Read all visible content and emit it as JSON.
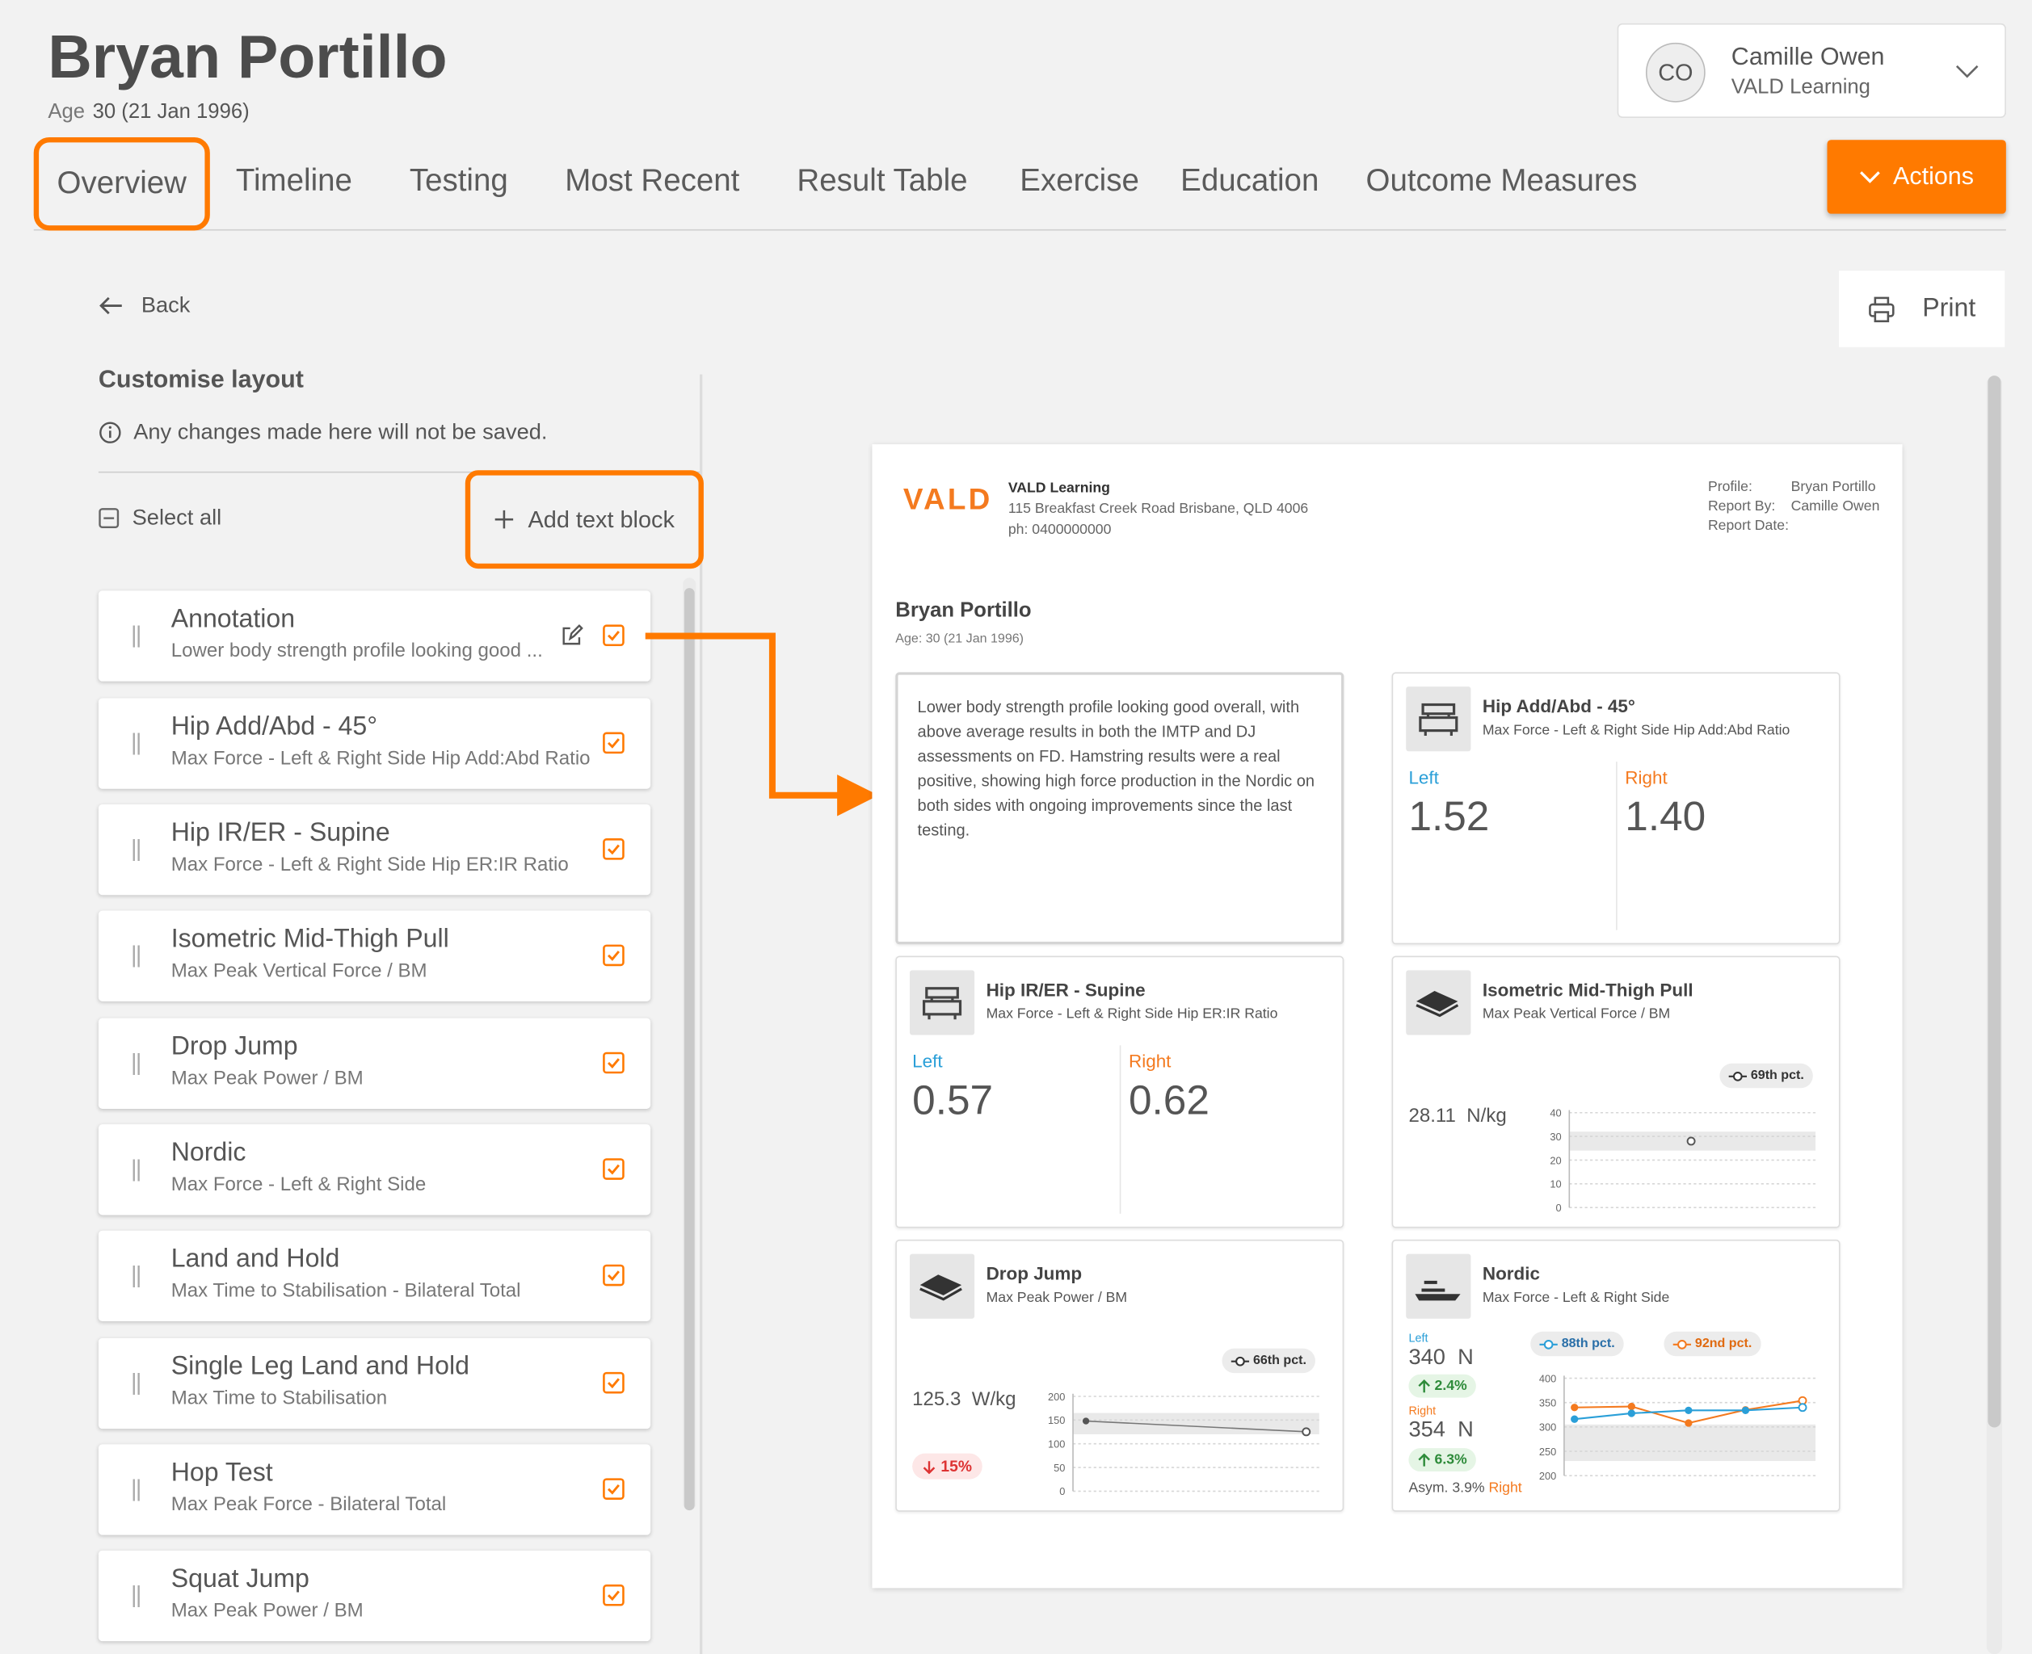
{
  "athlete": {
    "name": "Bryan Portillo",
    "age_label": "Age",
    "age_value": "30 (21 Jan 1996)"
  },
  "tabs": [
    {
      "label": "Overview",
      "active": true
    },
    {
      "label": "Timeline"
    },
    {
      "label": "Testing"
    },
    {
      "label": "Most Recent"
    },
    {
      "label": "Result Table"
    },
    {
      "label": "Exercise"
    },
    {
      "label": "Education"
    },
    {
      "label": "Outcome Measures"
    }
  ],
  "user": {
    "initials": "CO",
    "name": "Camille Owen",
    "org": "VALD Learning"
  },
  "actions_label": "Actions",
  "back_label": "Back",
  "print_label": "Print",
  "customise": {
    "title": "Customise layout",
    "note": "Any changes made here will not be saved.",
    "select_all": "Select all",
    "add_text_block": "Add text block",
    "items": [
      {
        "title": "Annotation",
        "subtitle": "Lower body strength profile looking good ...",
        "checked": true
      },
      {
        "title": "Hip Add/Abd - 45°",
        "subtitle": "Max Force - Left & Right Side Hip Add:Abd Ratio",
        "checked": true
      },
      {
        "title": "Hip IR/ER - Supine",
        "subtitle": "Max Force - Left & Right Side Hip ER:IR Ratio",
        "checked": true
      },
      {
        "title": "Isometric Mid-Thigh Pull",
        "subtitle": "Max Peak Vertical Force / BM",
        "checked": true
      },
      {
        "title": "Drop Jump",
        "subtitle": "Max Peak Power / BM",
        "checked": true
      },
      {
        "title": "Nordic",
        "subtitle": "Max Force - Left & Right Side",
        "checked": true
      },
      {
        "title": "Land and Hold",
        "subtitle": "Max Time to Stabilisation - Bilateral Total",
        "checked": true
      },
      {
        "title": "Single Leg Land and Hold",
        "subtitle": "Max Time to Stabilisation",
        "checked": true
      },
      {
        "title": "Hop Test",
        "subtitle": "Max Peak Force - Bilateral Total",
        "checked": true
      },
      {
        "title": "Squat Jump",
        "subtitle": "Max Peak Power / BM",
        "checked": true
      }
    ]
  },
  "report": {
    "logo": "VALD",
    "org_name": "VALD Learning",
    "address": "115 Breakfast Creek Road Brisbane, QLD 4006",
    "phone": "ph: 0400000000",
    "profile_label": "Profile:",
    "profile_value": "Bryan Portillo",
    "report_by_label": "Report By:",
    "report_by_value": "Camille Owen",
    "report_date_label": "Report Date:",
    "athlete_name": "Bryan Portillo",
    "athlete_age": "Age: 30 (21 Jan 1996)",
    "annotation": "Lower body strength profile looking good overall, with above average results in both the IMTP and DJ assessments on FD. Hamstring results were a real positive, showing high force production in the Nordic on both sides with ongoing improvements since the last testing.",
    "hip_add": {
      "title": "Hip Add/Abd - 45°",
      "subtitle": "Max Force - Left & Right Side Hip Add:Abd Ratio",
      "left_label": "Left",
      "left": "1.52",
      "right_label": "Right",
      "right": "1.40"
    },
    "hip_ir": {
      "title": "Hip IR/ER - Supine",
      "subtitle": "Max Force - Left & Right Side Hip ER:IR Ratio",
      "left_label": "Left",
      "left": "0.57",
      "right_label": "Right",
      "right": "0.62"
    },
    "imtp": {
      "title": "Isometric Mid-Thigh Pull",
      "subtitle": "Max Peak Vertical Force / BM",
      "value": "28.11",
      "unit": "N/kg",
      "pct": "69th pct.",
      "yticks": [
        "40",
        "30",
        "20",
        "10",
        "0"
      ],
      "points": [
        28
      ]
    },
    "drop_jump": {
      "title": "Drop Jump",
      "subtitle": "Max Peak Power / BM",
      "value": "125.3",
      "unit": "W/kg",
      "change": "15%",
      "pct": "66th pct.",
      "yticks": [
        "200",
        "150",
        "100",
        "50",
        "0"
      ],
      "points": [
        148,
        125.3
      ]
    },
    "nordic": {
      "title": "Nordic",
      "subtitle": "Max Force - Left & Right Side",
      "left_label": "Left",
      "left_value": "340",
      "left_unit": "N",
      "left_change": "2.4%",
      "right_label": "Right",
      "right_value": "354",
      "right_unit": "N",
      "right_change": "6.3%",
      "asym_label": "Asym. 3.9%",
      "asym_side": "Right",
      "left_pct": "88th pct.",
      "right_pct": "92nd pct.",
      "yticks": [
        "400",
        "350",
        "300",
        "250",
        "200"
      ],
      "left_series": [
        316,
        328,
        334,
        334,
        340
      ],
      "right_series": [
        340,
        342,
        308,
        335,
        354
      ]
    }
  },
  "colors": {
    "accent": "#ff7a00",
    "left": "#2a9fd8",
    "right": "#f47a1f"
  }
}
